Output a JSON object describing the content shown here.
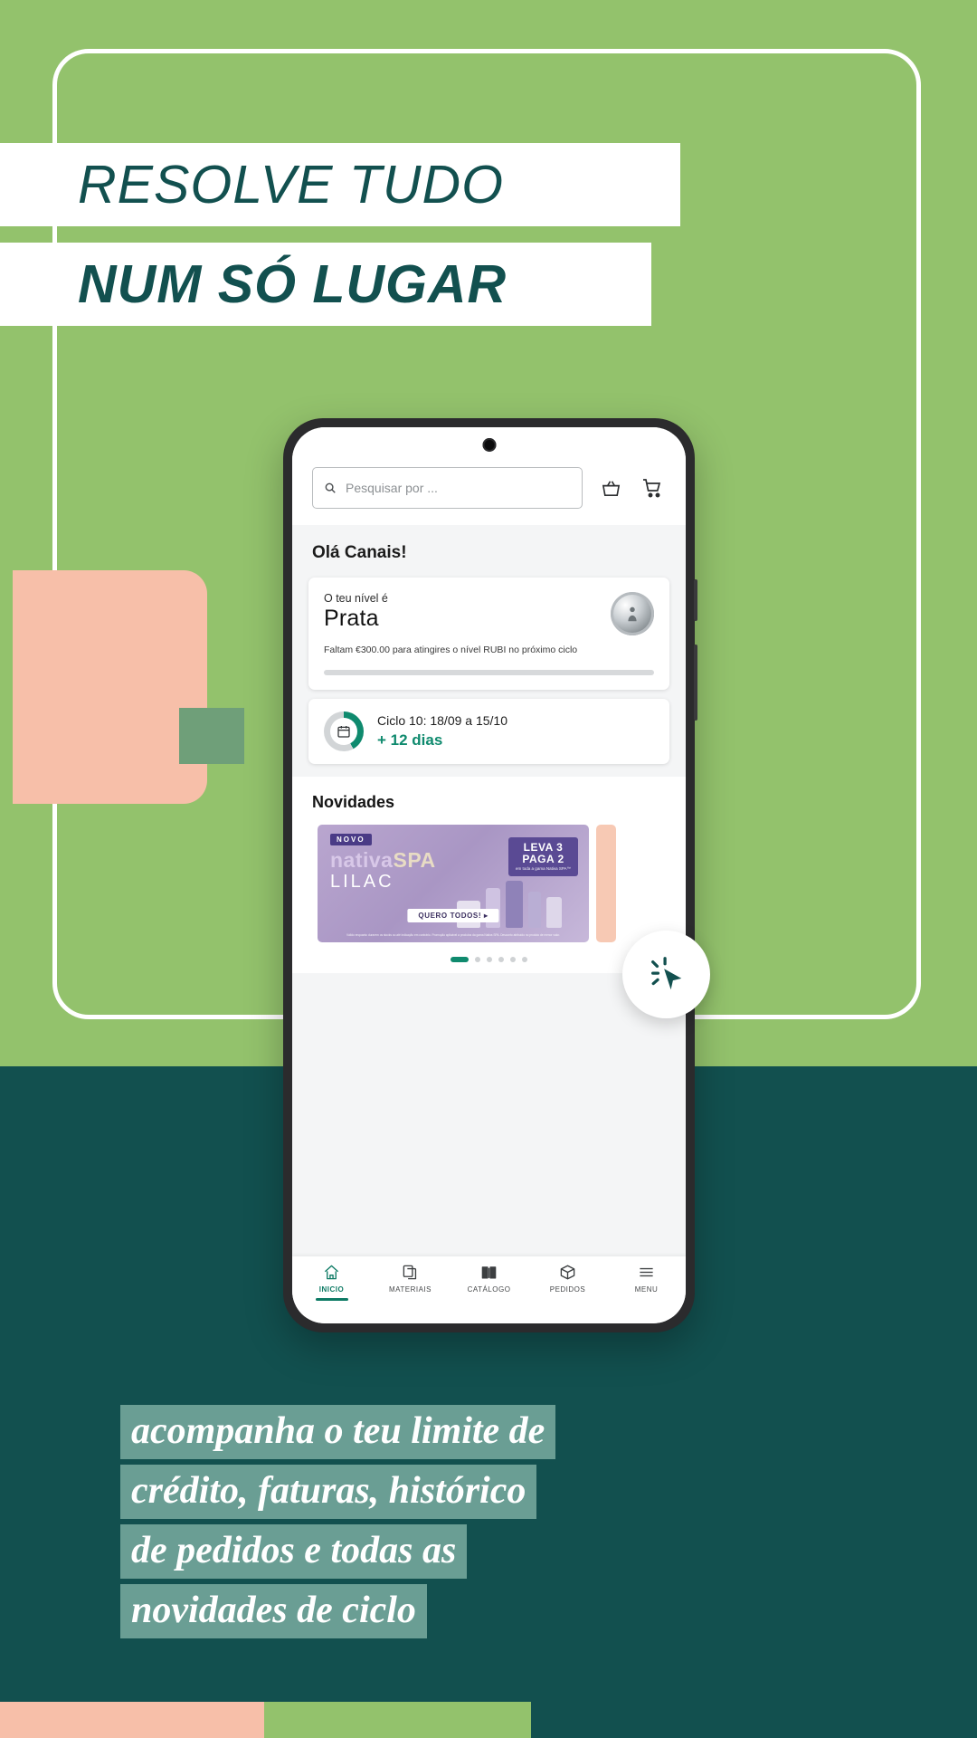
{
  "poster": {
    "headline_line1": "RESOLVE TUDO",
    "headline_line2": "NUM SÓ LUGAR",
    "caption_lines": [
      "acompanha o teu limite de",
      "crédito, faturas, histórico",
      "de pedidos e todas as",
      "novidades de ciclo"
    ],
    "colors": {
      "green": "#93c26c",
      "teal": "#12504f",
      "peach": "#f7bfa9",
      "sage": "#6a9e94",
      "accent_teal": "#0f8a6e"
    }
  },
  "app": {
    "search": {
      "placeholder": "Pesquisar por ...",
      "icon": "search-icon",
      "basket_icon": "basket-icon",
      "cart_icon": "shopping-cart-icon"
    },
    "greeting": "Olá Canais!",
    "level_card": {
      "subtitle": "O teu nível é",
      "level_name": "Prata",
      "note": "Faltam €300.00 para atingires o nível RUBI no próximo ciclo",
      "progress_percent": 0,
      "badge_icon": "medal-icon"
    },
    "cycle_card": {
      "icon": "calendar-icon",
      "dates": "Ciclo 10: 18/09 a 15/10",
      "days_left": "+ 12 dias",
      "ring_percent": 42
    },
    "news": {
      "title": "Novidades",
      "banner": {
        "tag": "NOVO",
        "brand": "nativaSPA",
        "brand_prefix": "nativa",
        "brand_suffix": "SPA",
        "variant": "LILAC",
        "promo_top": "LEVA 3",
        "promo_bottom": "PAGA 2",
        "promo_note": "em toda a gama Nativa SPA™",
        "cta": "QUERO TODOS! ▸",
        "legal": "Válido enquanto durarem os stocks ou até indicação em contrário. Promoção aplicável a produtos da gama Nativa SPA. Desconto atribuído no produto de menor valor."
      },
      "carousel_dots": 6,
      "carousel_active_index": 0
    },
    "nav": [
      {
        "label": "INICIO",
        "icon": "home-icon",
        "active": true
      },
      {
        "label": "MATERIAIS",
        "icon": "documents-icon",
        "active": false
      },
      {
        "label": "CATÁLOGO",
        "icon": "book-icon",
        "active": false
      },
      {
        "label": "PEDIDOS",
        "icon": "box-icon",
        "active": false
      },
      {
        "label": "MENU",
        "icon": "hamburger-icon",
        "active": false
      }
    ]
  },
  "cursor_badge": {
    "icon": "click-cursor-icon"
  }
}
